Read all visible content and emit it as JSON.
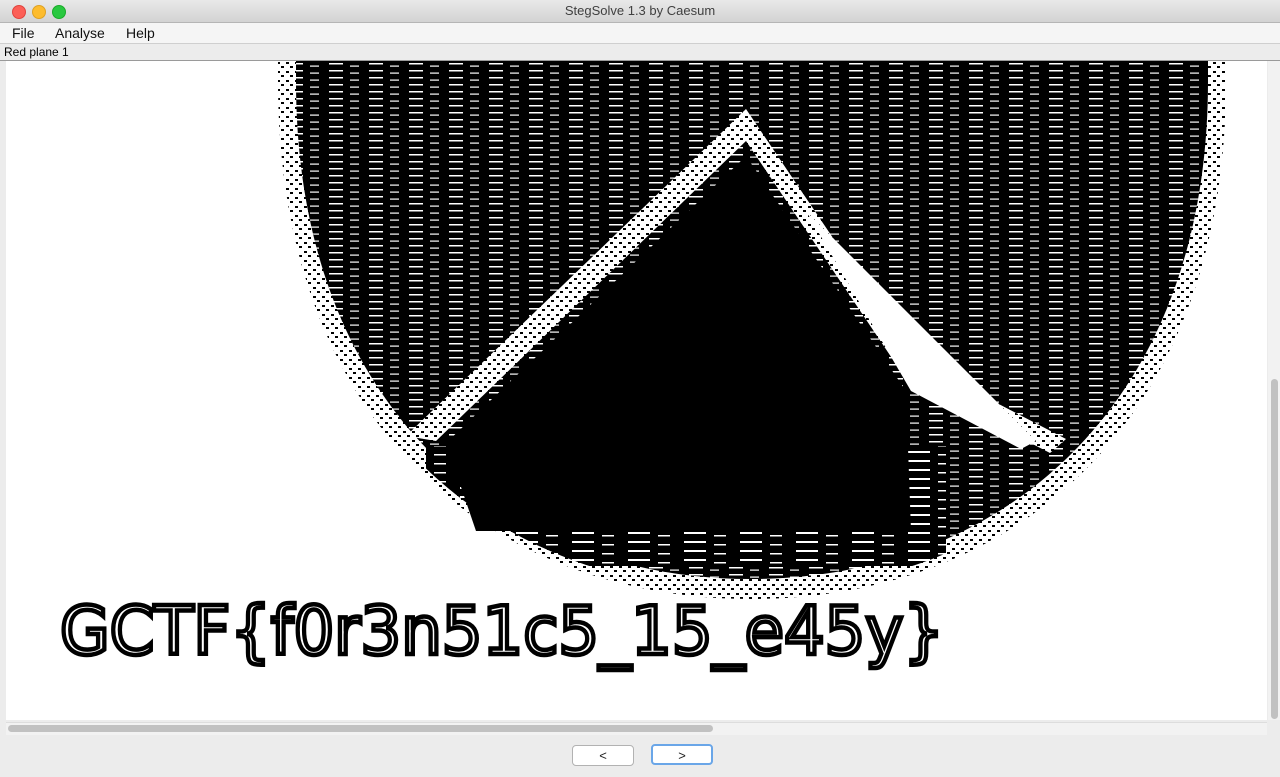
{
  "window": {
    "title": "StegSolve 1.3 by Caesum"
  },
  "menu": {
    "items": [
      "File",
      "Analyse",
      "Help"
    ]
  },
  "status": {
    "plane_label": "Red plane 1"
  },
  "image": {
    "flag_text": "GCTF{f0r3n51c5_15_e45y}"
  },
  "nav": {
    "prev_label": "<",
    "next_label": ">"
  }
}
